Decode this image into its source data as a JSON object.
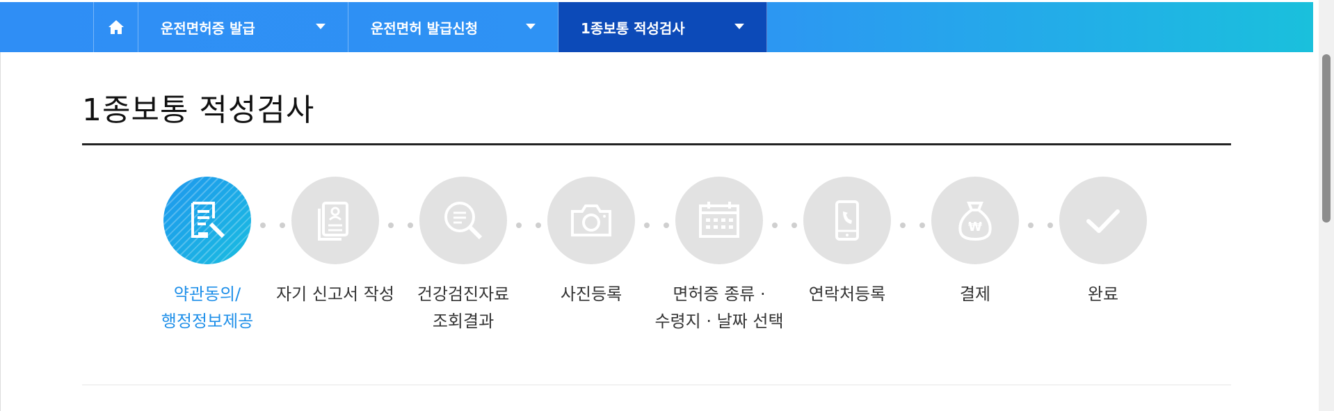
{
  "nav": {
    "home_icon": "home-icon",
    "menus": [
      {
        "label": "운전면허증 발급"
      },
      {
        "label": "운전면허 발급신청"
      },
      {
        "label": "1종보통 적성검사"
      }
    ]
  },
  "page": {
    "title": "1종보통 적성검사"
  },
  "steps": [
    {
      "line1": "약관동의/",
      "line2": "행정정보제공",
      "icon": "document-pen-icon",
      "active": true
    },
    {
      "line1": "자기 신고서 작성",
      "line2": "",
      "icon": "profile-document-icon",
      "active": false
    },
    {
      "line1": "건강검진자료",
      "line2": "조회결과",
      "icon": "search-icon",
      "active": false
    },
    {
      "line1": "사진등록",
      "line2": "",
      "icon": "camera-icon",
      "active": false
    },
    {
      "line1": "면허증 종류 ·",
      "line2": "수령지 · 날짜 선택",
      "icon": "calendar-icon",
      "active": false
    },
    {
      "line1": "연락처등록",
      "line2": "",
      "icon": "phone-icon",
      "active": false
    },
    {
      "line1": "결제",
      "line2": "",
      "icon": "money-bag-icon",
      "active": false
    },
    {
      "line1": "완료",
      "line2": "",
      "icon": "check-icon",
      "active": false
    }
  ],
  "colors": {
    "nav_gradient_start": "#2f8ef5",
    "nav_gradient_end": "#1ac0dc",
    "nav_active": "#0c4ab8",
    "step_active": "#1e97ee",
    "step_inactive": "#e2e2e2",
    "label_active": "#1e8fe9"
  }
}
